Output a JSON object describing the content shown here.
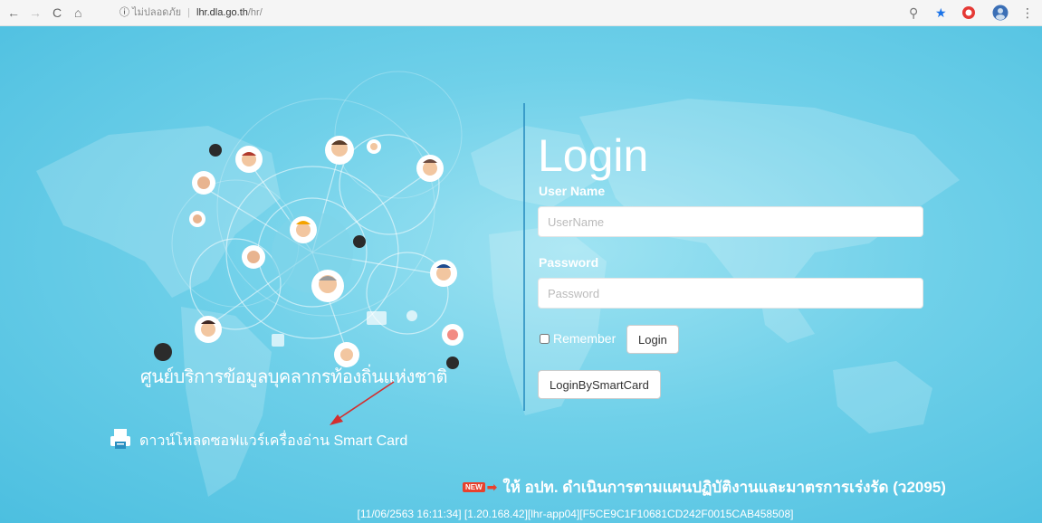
{
  "browser": {
    "back_glyph": "←",
    "forward_glyph": "→",
    "reload_glyph": "C",
    "home_glyph": "⌂",
    "info_glyph": "ⓘ",
    "insecure_label": "ไม่ปลอดภัย",
    "host": "lhr.dla.go.th",
    "path": "/hr/",
    "zoom_glyph": "⚲",
    "star_glyph": "★",
    "menu_glyph": "⋮",
    "colors": {
      "star": "#1a73e8",
      "ext_red": "#e53935",
      "ext_blue": "#3b6fb6"
    }
  },
  "left": {
    "center_title": "ศูนย์บริการข้อมูลบุคลากรท้องถิ่นแห่งชาติ",
    "download_text": "ดาวน์โหลดซอฟแวร์เครื่องอ่าน Smart Card"
  },
  "login": {
    "title": "Login",
    "username_label": "User Name",
    "username_placeholder": "UserName",
    "password_label": "Password",
    "password_placeholder": "Password",
    "remember_label": "Remember",
    "login_button": "Login",
    "smartcard_button": "LoginBySmartCard"
  },
  "news": {
    "badge": "NEW",
    "text": "ให้ อปท. ดำเนินการตามแผนปฏิบัติงานและมาตรการเร่งรัด (ว2095)"
  },
  "footer": {
    "status": "[11/06/2563 16:11:34] [1.20.168.42][lhr-app04][F5CE9C1F10681CD242F0015CAB458508]"
  },
  "colors": {
    "background": "#6fd0e9",
    "divider": "#2a8fc0",
    "annotation_arrow": "#d32f2f"
  }
}
